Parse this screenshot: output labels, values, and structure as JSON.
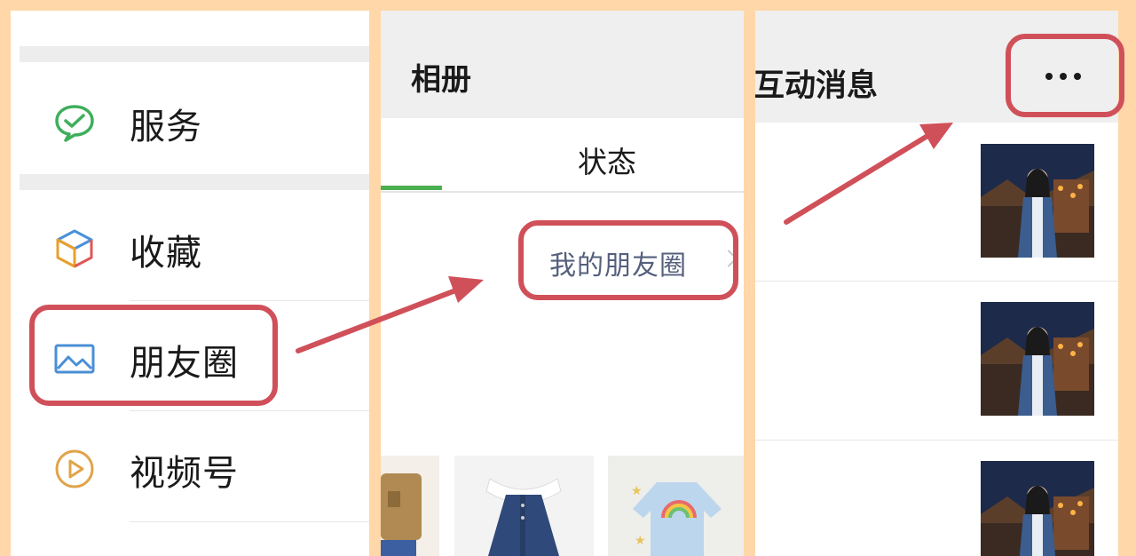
{
  "me_menu": {
    "items": [
      {
        "label": "服务",
        "icon": "wechat-pay-icon"
      },
      {
        "label": "收藏",
        "icon": "favorites-cube-icon"
      },
      {
        "label": "朋友圈",
        "icon": "moments-picture-icon"
      },
      {
        "label": "视频号",
        "icon": "channels-play-icon"
      }
    ]
  },
  "album": {
    "title": "相册",
    "tab_status": "状态",
    "moments_link": "我的朋友圈"
  },
  "interactions": {
    "title": "互动消息",
    "more_icon": "more-dots-icon"
  },
  "colors": {
    "background": "#ffd7a8",
    "highlight": "#d0505a",
    "tab_indicator": "#4caf50",
    "link_text": "#55607d"
  }
}
